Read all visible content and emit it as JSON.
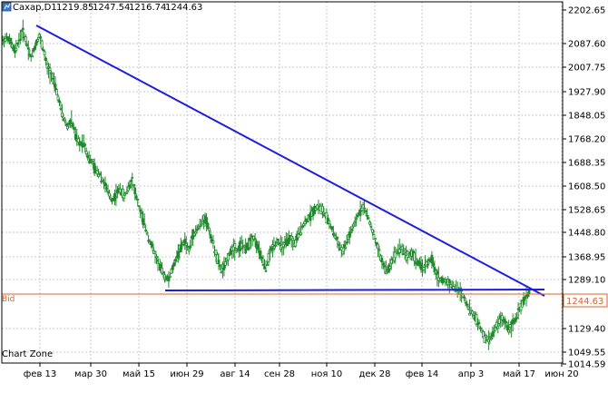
{
  "header": {
    "symbol": "Сахар,D1",
    "open": "1219.85",
    "high": "1247.54",
    "low": "1216.74",
    "close": "1244.63"
  },
  "watermark": "Chart Zone",
  "bid": {
    "label": "Bid",
    "price": "1244.63",
    "value": 1244.63,
    "color": "#e0602a"
  },
  "colors": {
    "candle_up": "#1f8a2c",
    "candle_down": "#1f8a2c",
    "trendline": "#1d1de0",
    "grid": "#c8c8c8"
  },
  "chart_data": {
    "type": "candlestick",
    "y_ticks": [
      "2202.65",
      "2087.60",
      "2007.75",
      "1927.90",
      "1848.05",
      "1768.20",
      "1688.35",
      "1608.50",
      "1528.65",
      "1448.80",
      "1368.95",
      "1289.10",
      "1129.40",
      "1049.55",
      "1014.59"
    ],
    "y_tick_values": [
      2202.65,
      2087.6,
      2007.75,
      1927.9,
      1848.05,
      1768.2,
      1688.35,
      1608.5,
      1528.65,
      1448.8,
      1368.95,
      1289.1,
      1129.4,
      1049.55,
      1014.59
    ],
    "x_ticks": [
      "фев 13",
      "мар 30",
      "май 15",
      "июн 29",
      "авг 14",
      "сен 28",
      "ноя 10",
      "дек 28",
      "фев 14",
      "апр 3",
      "май 17",
      "июн 20"
    ],
    "ylim": [
      1014.59,
      2220
    ],
    "grid": true,
    "trendlines": [
      {
        "name": "",
        "from": {
          "date": "фев 13",
          "price": 2145
        },
        "to": {
          "date": "июн 20",
          "price": 1250
        }
      },
      {
        "name": "",
        "from": {
          "date": "июн 29",
          "price": 1281
        },
        "to": {
          "date": "июн 20",
          "price": 1283
        }
      }
    ],
    "series_path": [
      [
        0,
        2095
      ],
      [
        3,
        2110
      ],
      [
        6,
        2090
      ],
      [
        9,
        2060
      ],
      [
        12,
        2100
      ],
      [
        15,
        2130
      ],
      [
        18,
        2085
      ],
      [
        21,
        2040
      ],
      [
        24,
        2080
      ],
      [
        27,
        2115
      ],
      [
        30,
        2070
      ],
      [
        33,
        2005
      ],
      [
        36,
        1985
      ],
      [
        39,
        1945
      ],
      [
        42,
        1890
      ],
      [
        45,
        1840
      ],
      [
        48,
        1810
      ],
      [
        51,
        1830
      ],
      [
        54,
        1780
      ],
      [
        57,
        1750
      ],
      [
        60,
        1760
      ],
      [
        63,
        1710
      ],
      [
        66,
        1690
      ],
      [
        69,
        1660
      ],
      [
        72,
        1650
      ],
      [
        75,
        1620
      ],
      [
        78,
        1590
      ],
      [
        81,
        1560
      ],
      [
        84,
        1580
      ],
      [
        87,
        1600
      ],
      [
        90,
        1570
      ],
      [
        93,
        1605
      ],
      [
        96,
        1630
      ],
      [
        99,
        1570
      ],
      [
        102,
        1520
      ],
      [
        105,
        1480
      ],
      [
        108,
        1430
      ],
      [
        111,
        1400
      ],
      [
        114,
        1360
      ],
      [
        117,
        1330
      ],
      [
        120,
        1300
      ],
      [
        123,
        1290
      ],
      [
        126,
        1330
      ],
      [
        129,
        1370
      ],
      [
        132,
        1400
      ],
      [
        135,
        1420
      ],
      [
        138,
        1390
      ],
      [
        141,
        1440
      ],
      [
        144,
        1460
      ],
      [
        147,
        1480
      ],
      [
        150,
        1500
      ],
      [
        153,
        1455
      ],
      [
        156,
        1410
      ],
      [
        159,
        1360
      ],
      [
        162,
        1320
      ],
      [
        165,
        1340
      ],
      [
        168,
        1380
      ],
      [
        171,
        1400
      ],
      [
        174,
        1390
      ],
      [
        177,
        1410
      ],
      [
        180,
        1395
      ],
      [
        183,
        1420
      ],
      [
        186,
        1430
      ],
      [
        189,
        1400
      ],
      [
        192,
        1360
      ],
      [
        195,
        1330
      ],
      [
        198,
        1380
      ],
      [
        201,
        1410
      ],
      [
        204,
        1420
      ],
      [
        207,
        1400
      ],
      [
        210,
        1415
      ],
      [
        213,
        1430
      ],
      [
        216,
        1410
      ],
      [
        219,
        1440
      ],
      [
        222,
        1470
      ],
      [
        225,
        1490
      ],
      [
        228,
        1510
      ],
      [
        231,
        1530
      ],
      [
        234,
        1540
      ],
      [
        237,
        1525
      ],
      [
        240,
        1500
      ],
      [
        243,
        1470
      ],
      [
        246,
        1440
      ],
      [
        249,
        1410
      ],
      [
        252,
        1380
      ],
      [
        255,
        1420
      ],
      [
        258,
        1450
      ],
      [
        261,
        1480
      ],
      [
        264,
        1520
      ],
      [
        267,
        1540
      ],
      [
        270,
        1510
      ],
      [
        273,
        1470
      ],
      [
        276,
        1420
      ],
      [
        279,
        1380
      ],
      [
        282,
        1340
      ],
      [
        285,
        1320
      ],
      [
        288,
        1350
      ],
      [
        291,
        1380
      ],
      [
        294,
        1400
      ],
      [
        297,
        1390
      ],
      [
        300,
        1370
      ],
      [
        303,
        1380
      ],
      [
        306,
        1360
      ],
      [
        309,
        1340
      ],
      [
        312,
        1330
      ],
      [
        315,
        1350
      ],
      [
        318,
        1360
      ],
      [
        321,
        1310
      ],
      [
        324,
        1290
      ],
      [
        327,
        1285
      ],
      [
        330,
        1280
      ],
      [
        333,
        1270
      ],
      [
        336,
        1260
      ],
      [
        339,
        1250
      ],
      [
        342,
        1230
      ],
      [
        345,
        1200
      ],
      [
        348,
        1180
      ],
      [
        351,
        1160
      ],
      [
        354,
        1130
      ],
      [
        357,
        1100
      ],
      [
        360,
        1090
      ],
      [
        363,
        1110
      ],
      [
        366,
        1140
      ],
      [
        369,
        1160
      ],
      [
        372,
        1150
      ],
      [
        375,
        1130
      ],
      [
        378,
        1145
      ],
      [
        381,
        1170
      ],
      [
        384,
        1200
      ],
      [
        387,
        1230
      ],
      [
        390,
        1245
      ]
    ]
  }
}
